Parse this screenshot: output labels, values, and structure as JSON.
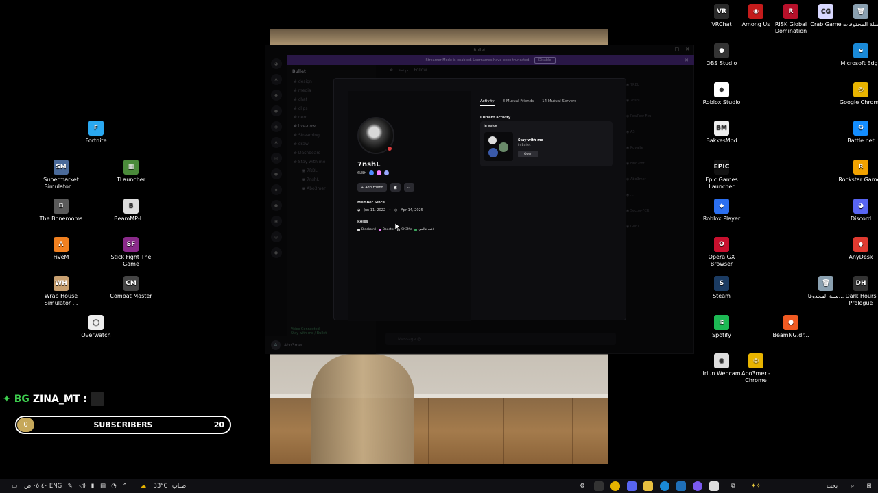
{
  "desktop": {
    "icons_right": [
      {
        "label": "VRChat",
        "glyph": "VR",
        "color": "#2a2a2a",
        "icon": "vrchat-icon"
      },
      {
        "label": "Among Us",
        "glyph": "◉",
        "color": "#c41b1b",
        "icon": "among-us-icon"
      },
      {
        "label": "RISK Global Domination",
        "glyph": "R",
        "color": "#b8102a",
        "icon": "risk-icon"
      },
      {
        "label": "Crab Game",
        "glyph": "CG",
        "color": "#d8d8ff",
        "icon": "crab-game-icon"
      },
      {
        "label": "سلة المحذوفات",
        "glyph": "🗑",
        "color": "#8aa0b0",
        "icon": "recycle-bin-icon"
      },
      {
        "label": "OBS Studio",
        "glyph": "●",
        "color": "#333",
        "icon": "obs-icon"
      },
      {
        "label": "Microsoft Edge",
        "glyph": "e",
        "color": "#1a8ad8",
        "icon": "edge-icon"
      },
      {
        "label": "Roblox Studio",
        "glyph": "◆",
        "color": "#fff",
        "icon": "roblox-studio-icon"
      },
      {
        "label": "Google Chrome",
        "glyph": "◎",
        "color": "#e8b400",
        "icon": "chrome-icon"
      },
      {
        "label": "BakkesMod",
        "glyph": "BM",
        "color": "#eee",
        "icon": "bakkesmod-icon"
      },
      {
        "label": "Battle.net",
        "glyph": "✪",
        "color": "#148eff",
        "icon": "battlenet-icon"
      },
      {
        "label": "Epic Games Launcher",
        "glyph": "EPIC",
        "color": "#111",
        "icon": "epic-games-icon"
      },
      {
        "label": "Rockstar Games ...",
        "glyph": "R",
        "color": "#f1a200",
        "icon": "rockstar-icon"
      },
      {
        "label": "Roblox Player",
        "glyph": "◆",
        "color": "#2b6ff0",
        "icon": "roblox-player-icon"
      },
      {
        "label": "Discord",
        "glyph": "◕",
        "color": "#5865f2",
        "icon": "discord-icon"
      },
      {
        "label": "Opera GX Browser",
        "glyph": "O",
        "color": "#c8102e",
        "icon": "opera-gx-icon"
      },
      {
        "label": "AnyDesk",
        "glyph": "◆",
        "color": "#e03a30",
        "icon": "anydesk-icon"
      },
      {
        "label": "Steam",
        "glyph": "S",
        "color": "#1b3b62",
        "icon": "steam-icon"
      },
      {
        "label": "سلة المحذوفا...",
        "glyph": "🗑",
        "color": "#8aa0b0",
        "icon": "recycle-bin-full-icon"
      },
      {
        "label": "Dark Hours Prologue",
        "glyph": "DH",
        "color": "#333",
        "icon": "dark-hours-icon"
      },
      {
        "label": "Spotify",
        "glyph": "≋",
        "color": "#1db954",
        "icon": "spotify-icon"
      },
      {
        "label": "BeamNG.dr...",
        "glyph": "●",
        "color": "#f05a22",
        "icon": "beamng-icon"
      },
      {
        "label": "Iriun Webcam",
        "glyph": "◉",
        "color": "#ddd",
        "icon": "iriun-webcam-icon"
      },
      {
        "label": "Abo3mer - Chrome",
        "glyph": "◎",
        "color": "#e8b400",
        "icon": "chrome-profile-icon"
      }
    ],
    "icons_left": [
      {
        "label": "Fortnite",
        "glyph": "F",
        "color": "#2aa8f0",
        "icon": "fortnite-icon"
      },
      {
        "label": "Supermarket Simulator ...",
        "glyph": "SM",
        "color": "#4a6a9a",
        "icon": "supermarket-icon"
      },
      {
        "label": "TLauncher",
        "glyph": "▦",
        "color": "#4a8a3a",
        "icon": "tlauncher-icon"
      },
      {
        "label": "The Bonerooms",
        "glyph": "B",
        "color": "#5a5a5a",
        "icon": "bonerooms-icon"
      },
      {
        "label": "BeamMP-L...",
        "glyph": "B",
        "color": "#ddd",
        "icon": "beammp-icon"
      },
      {
        "label": "FiveM",
        "glyph": "Λ",
        "color": "#f08020",
        "icon": "fivem-icon"
      },
      {
        "label": "Stick Fight The Game",
        "glyph": "SF",
        "color": "#8a2a8a",
        "icon": "stick-fight-icon"
      },
      {
        "label": "Wrap House Simulator ...",
        "glyph": "WH",
        "color": "#c8a070",
        "icon": "wrap-house-icon"
      },
      {
        "label": "Combat Master",
        "glyph": "CM",
        "color": "#444",
        "icon": "combat-master-icon"
      },
      {
        "label": "Overwatch",
        "glyph": "◯",
        "color": "#eee",
        "icon": "overwatch-icon"
      }
    ]
  },
  "discord": {
    "title": "Bullet",
    "streamer_banner": "Streamer Mode is enabled. Usernames have been truncated.",
    "banner_button": "Disable",
    "server_name": "Bullet",
    "channels": [
      "design",
      "media",
      "chat",
      "clips",
      "nerd",
      "live-now",
      "Streaming",
      "draw",
      "Dashboard",
      "Stay with me"
    ],
    "voice_members": [
      "7RBL",
      "7nshL",
      "Abo3mer"
    ],
    "voice_status": "Voice Connected",
    "voice_sub": "Stay with me / Bullet",
    "user_name": "Abo3mer",
    "chat_header_channel": "مهنمة",
    "chat_header_follow": "Follow",
    "message_placeholder": "Message @...",
    "members": [
      "7RBL",
      "7nshL",
      "PewPew Fcu",
      "AS",
      "Royalte",
      "Fibo7rbr",
      "Abo3mer",
      "...",
      "Sector-FCR",
      "Guru"
    ],
    "profile": {
      "username": "7nshL",
      "tag": "6LBH",
      "add_friend": "Add Friend",
      "member_since_label": "Member Since",
      "date_discord": "Jun 11, 2022",
      "date_server": "Apr 14, 2025",
      "roles_label": "Roles",
      "roles": [
        {
          "name": "Blackbird",
          "color": "#dddddd"
        },
        {
          "name": "Booster",
          "color": "#f47fff"
        },
        {
          "name": "Sh3Me",
          "color": "#aaaaaa"
        },
        {
          "name": "لاعب عالمي",
          "color": "#3ba55c"
        }
      ],
      "tabs": [
        "Activity",
        "8 Mutual Friends",
        "14 Mutual Servers"
      ],
      "current_activity_label": "Current activity",
      "in_voice_label": "In voice",
      "activity_title": "Stay with me",
      "activity_sub": "in Bullet",
      "open_button": "Open"
    }
  },
  "overlay": {
    "streamer_name": "ZINA_MT :",
    "sub_label": "SUBSCRIBERS",
    "sub_current": "0",
    "sub_goal": "20"
  },
  "taskbar": {
    "time": "٠٥:٤٠ ص",
    "lang": "ENG",
    "weather": "33°C",
    "weather_desc": "ضباب",
    "search": "بحث"
  }
}
